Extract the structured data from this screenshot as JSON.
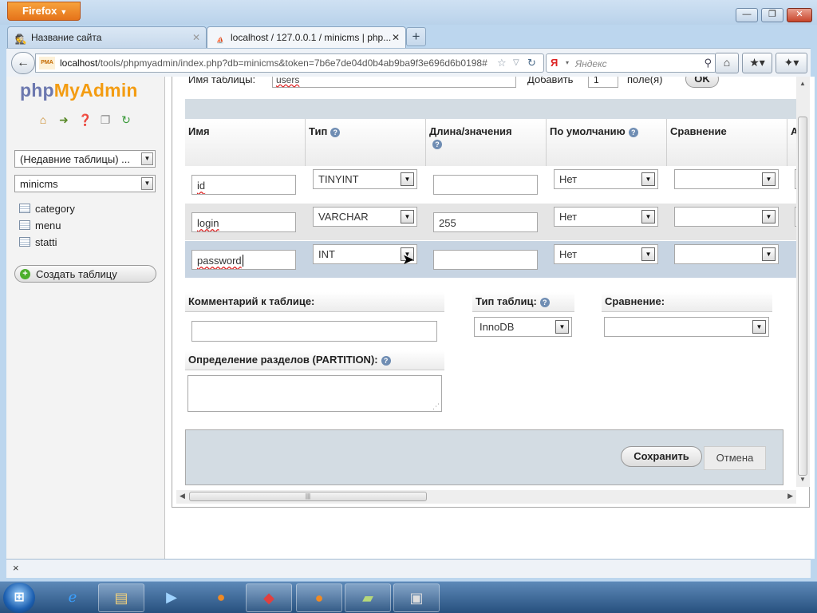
{
  "browser": {
    "menu_button": "Firefox",
    "menu_arrow": "▼",
    "window_controls": {
      "minimize": "—",
      "maximize": "❐",
      "close": "✕"
    },
    "tabs": [
      {
        "title": "Название сайта",
        "icon": "spy-icon",
        "active": false
      },
      {
        "title": "localhost / 127.0.0.1 / minicms | php...",
        "icon": "pma-icon",
        "active": true
      }
    ],
    "new_tab": "+",
    "url": {
      "host": "localhost",
      "path": "/tools/phpmyadmin/index.php?db=minicms&token=7b6e7de04d0b4ab9ba9f3e696d6b0198#"
    },
    "favicon_label": "PMA",
    "search": {
      "engine": "Я",
      "placeholder": "Яндекс"
    }
  },
  "sidebar": {
    "logo": {
      "php": "php",
      "my": "My",
      "admin": "Admin"
    },
    "recent_tables": "(Недавние таблицы) ...",
    "database": "minicms",
    "tables": [
      "category",
      "menu",
      "statti"
    ],
    "create_table": "Создать таблицу"
  },
  "main": {
    "top_row": {
      "table_name_label": "Имя таблицы:",
      "table_name_value": "users",
      "add_label": "Добавить",
      "add_value": "1",
      "fields_label": "поле(я)",
      "ok": "OK"
    },
    "columns": [
      "Имя",
      "Тип",
      "Длина/значения",
      "По умолчанию",
      "Сравнение",
      "A"
    ],
    "rows": [
      {
        "name": "id",
        "type": "TINYINT",
        "length": "",
        "default": "Нет",
        "collation": ""
      },
      {
        "name": "login",
        "type": "VARCHAR",
        "length": "255",
        "default": "Нет",
        "collation": ""
      },
      {
        "name": "password",
        "type": "INT",
        "length": "",
        "default": "Нет",
        "collation": ""
      }
    ],
    "comment_label": "Комментарий к таблице:",
    "engine_label": "Тип таблиц:",
    "engine_value": "InnoDB",
    "collation_label": "Сравнение:",
    "partition_label": "Определение разделов (PARTITION):",
    "save": "Сохранить",
    "cancel": "Отмена"
  },
  "findbar": {
    "close": "×"
  }
}
